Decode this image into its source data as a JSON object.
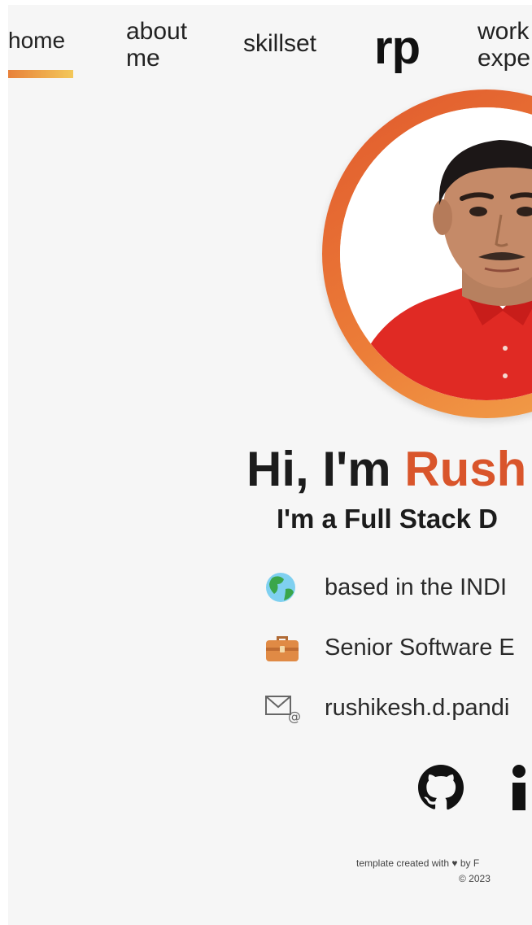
{
  "nav": {
    "home": "home",
    "about_line1": "about",
    "about_line2": "me",
    "skillset": "skillset",
    "logo": "rp",
    "work_line1": "work",
    "work_line2": "expe"
  },
  "hero": {
    "greeting": "Hi, I'm ",
    "name": "Rush",
    "role": "I'm a Full Stack D"
  },
  "info": {
    "location": "based in the INDI",
    "job": "Senior Software E",
    "email": "rushikesh.d.pandi"
  },
  "footer": {
    "credit": "template created with ♥ by F",
    "copyright": "© 2023"
  },
  "colors": {
    "accent": "#d9552b",
    "ring_gradient": [
      "#e0592d",
      "#f3a54c"
    ],
    "underline_gradient": [
      "#e8813a",
      "#f3c85a"
    ]
  },
  "icons": {
    "location": "globe-icon",
    "job": "briefcase-icon",
    "email": "email-icon",
    "social": [
      "github-icon",
      "linkedin-icon"
    ]
  }
}
